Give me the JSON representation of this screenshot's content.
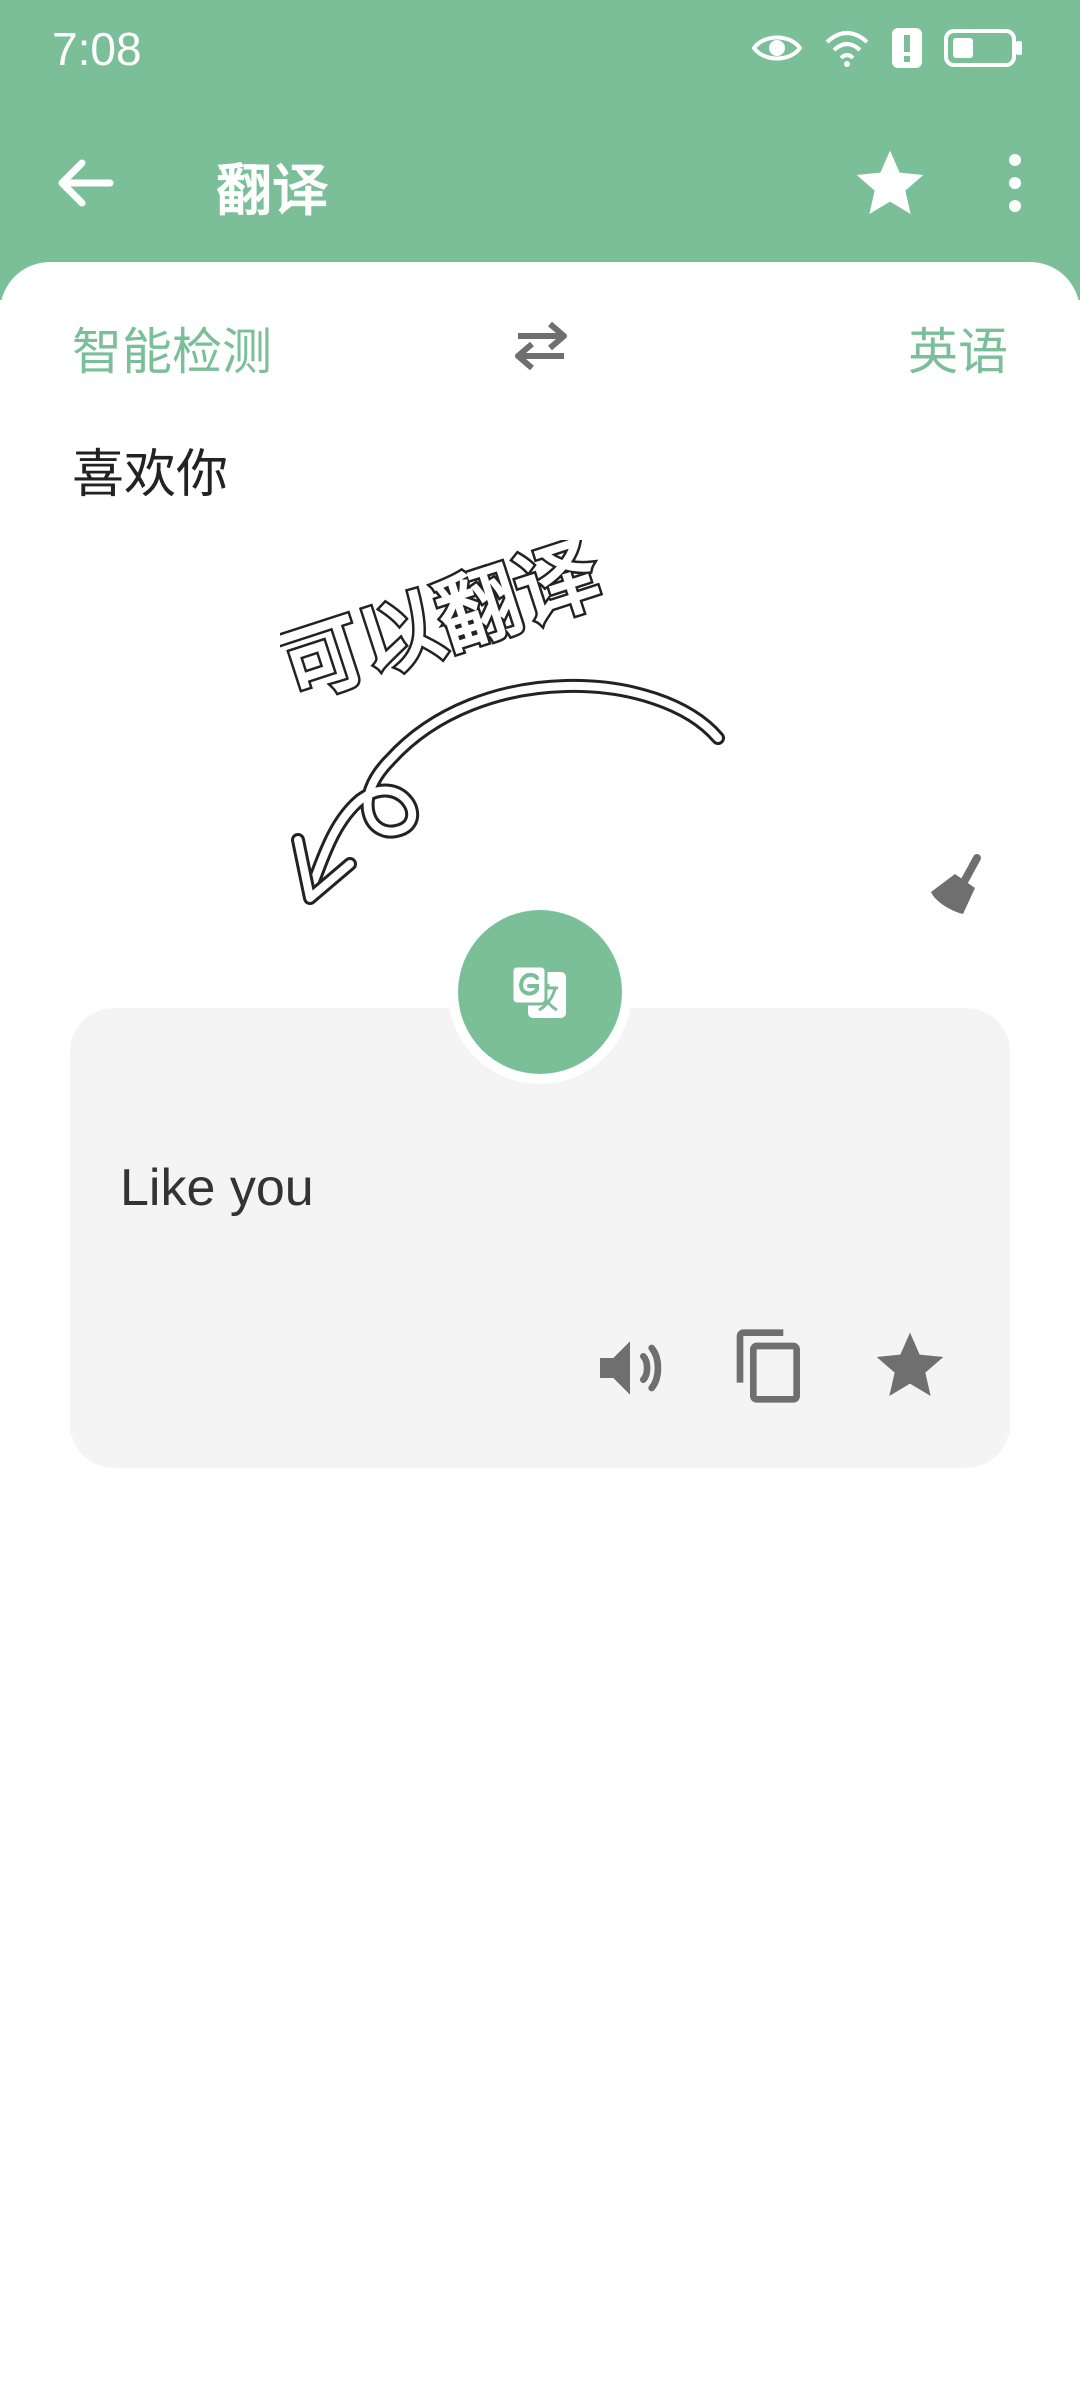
{
  "status_bar": {
    "time": "7:08",
    "icons": [
      "eye-icon",
      "wifi-icon",
      "alert-icon",
      "battery-icon"
    ]
  },
  "app_bar": {
    "title": "翻译",
    "back_icon": "arrow-back-icon",
    "star_icon": "star-icon",
    "more_icon": "more-vert-icon"
  },
  "languages": {
    "source": "智能检测",
    "target": "英语",
    "swap_icon": "swap-horiz-icon"
  },
  "input": {
    "text": "喜欢你"
  },
  "sticker": {
    "text": "可以翻译"
  },
  "result": {
    "text": "Like you",
    "actions": [
      "volume-icon",
      "copy-icon",
      "star-icon"
    ]
  },
  "colors": {
    "accent": "#7bbf99",
    "card": "#f4f4f4",
    "icon_gray": "#6f6f6f"
  }
}
